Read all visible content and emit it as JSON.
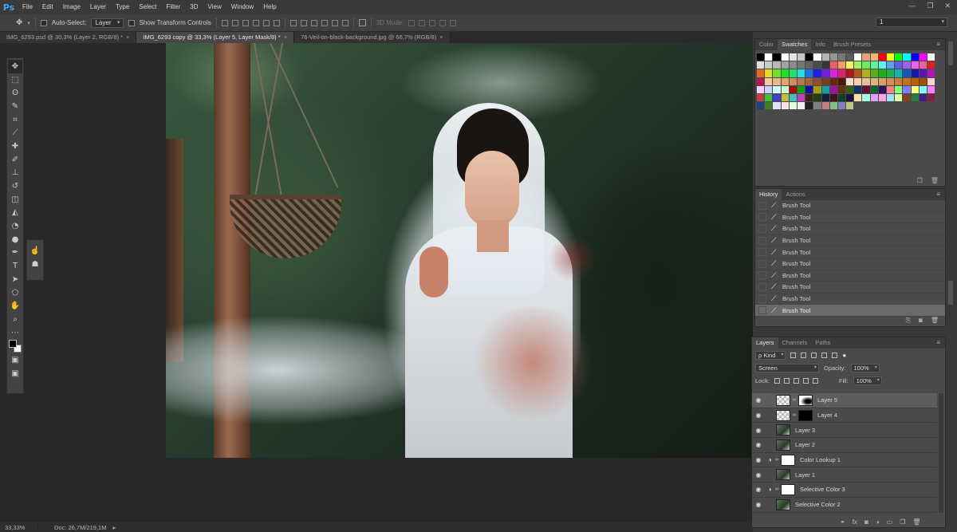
{
  "app": {
    "logo": "Ps",
    "menu": [
      "File",
      "Edit",
      "Image",
      "Layer",
      "Type",
      "Select",
      "Filter",
      "3D",
      "View",
      "Window",
      "Help"
    ],
    "window_controls": [
      "—",
      "❐",
      "✕"
    ]
  },
  "options": {
    "auto_select_label": "Auto-Select:",
    "auto_select_value": "Layer",
    "show_transform_label": "Show Transform Controls",
    "mode_3d_label": "3D Mode:",
    "workspace_value": "1"
  },
  "tabs": [
    {
      "label": "IMG_6293.psd @ 30,3% (Layer 2, RGB/8) *",
      "active": false
    },
    {
      "label": "IMG_6293 copy @ 33,3% (Layer 5, Layer Mask/8) *",
      "active": true
    },
    {
      "label": "76-Veil-on-black-background.jpg @ 66,7% (RGB/8)",
      "active": false
    }
  ],
  "tools": [
    "move-tool",
    "marquee-tool",
    "lasso-tool",
    "quick-select-tool",
    "crop-tool",
    "eyedropper-tool",
    "healing-tool",
    "brush-tool",
    "stamp-tool",
    "history-brush-tool",
    "eraser-tool",
    "paint-bucket-tool",
    "blur-tool",
    "dodge-tool",
    "pen-tool",
    "type-tool",
    "path-select-tool",
    "shape-tool",
    "hand-tool",
    "zoom-tool",
    "more-tools"
  ],
  "status": {
    "zoom": "33,33%",
    "doc": "Doc: 26,7M/219,1M"
  },
  "swatches_panel": {
    "tabs": [
      "Color",
      "Swatches",
      "Info",
      "Brush Presets"
    ],
    "active_tab": "Swatches",
    "colors": [
      "#000000",
      "#ffffff",
      "#000000",
      "#ffffff",
      "#e6e6e6",
      "#c8c8c8",
      "#000000",
      "#ffffff",
      "#b4b4b4",
      "#969696",
      "#787878",
      "#5a5a5a",
      "#ffffff",
      "#e8a080",
      "#f0b870",
      "#ff0000",
      "#ffff00",
      "#00ff00",
      "#00ffff",
      "#0000ff",
      "#ff00ff",
      "#f6f6f6",
      "#e0e0e0",
      "#cbcbcb",
      "#b6b6b6",
      "#a0a0a0",
      "#8b8b8b",
      "#767676",
      "#616161",
      "#4b4b4b",
      "#363636",
      "#f06060",
      "#f0a060",
      "#f0f060",
      "#a0f060",
      "#60f060",
      "#60f0a0",
      "#60f0f0",
      "#60a0f0",
      "#6060f0",
      "#a060f0",
      "#f060f0",
      "#f060a0",
      "#e02020",
      "#e07020",
      "#e0e020",
      "#70e020",
      "#20e020",
      "#20e070",
      "#20e0e0",
      "#2070e0",
      "#2020e0",
      "#7020e0",
      "#e020e0",
      "#e02070",
      "#b01818",
      "#b05818",
      "#b0b018",
      "#58b018",
      "#18b018",
      "#18b058",
      "#18b0b0",
      "#1858b0",
      "#1818b0",
      "#5818b0",
      "#b018b0",
      "#b01858",
      "#f4c8a0",
      "#e8b888",
      "#dca870",
      "#c89060",
      "#b47850",
      "#a06440",
      "#8c5030",
      "#783c20",
      "#642810",
      "#501800",
      "#f8e0c8",
      "#f0d0b0",
      "#e8c098",
      "#e0b080",
      "#d8a068",
      "#d09050",
      "#c88038",
      "#c07020",
      "#b86008",
      "#a05000",
      "#ffd0d0",
      "#ffd0ff",
      "#d0d0ff",
      "#d0ffff",
      "#d0ffd0",
      "#a01010",
      "#10a010",
      "#1010a0",
      "#a0a010",
      "#10a0a0",
      "#a010a0",
      "#603010",
      "#306010",
      "#103060",
      "#601030",
      "#106030",
      "#301060",
      "#ff8080",
      "#80ff80",
      "#8080ff",
      "#ffff80",
      "#80ffff",
      "#ff80ff",
      "#c04040",
      "#40c040",
      "#4040c0",
      "#c0c040",
      "#40c0c0",
      "#c040c0",
      "#402010",
      "#204010",
      "#102040",
      "#401020",
      "#104020",
      "#201040",
      "#ffe0a0",
      "#a0ffe0",
      "#e0a0ff",
      "#ffa0e0",
      "#a0e0ff",
      "#e0ffa0",
      "#804020",
      "#208040",
      "#402080",
      "#802040",
      "#204080",
      "#408020",
      "#e0e0ff",
      "#ffe0e0",
      "#e0ffe0",
      "#f0f0f0",
      "#202020",
      "#808080",
      "#c08080",
      "#80c080",
      "#8080c0",
      "#c0c080"
    ]
  },
  "history_panel": {
    "tabs": [
      "History",
      "Actions"
    ],
    "active_tab": "History",
    "items": [
      "Brush Tool",
      "Brush Tool",
      "Brush Tool",
      "Brush Tool",
      "Brush Tool",
      "Brush Tool",
      "Brush Tool",
      "Brush Tool",
      "Brush Tool",
      "Brush Tool"
    ],
    "active_index": 9
  },
  "layers_panel": {
    "tabs": [
      "Layers",
      "Channels",
      "Paths"
    ],
    "active_tab": "Layers",
    "filter_label": "ρ Kind",
    "blend_mode": "Screen",
    "opacity_label": "Opacity:",
    "opacity_value": "100%",
    "lock_label": "Lock:",
    "fill_label": "Fill:",
    "fill_value": "100%",
    "layers": [
      {
        "name": "Layer 5",
        "thumb": "checker",
        "mask": "mask5",
        "adj": false,
        "active": true
      },
      {
        "name": "Layer 4",
        "thumb": "checker",
        "mask": "black",
        "adj": false,
        "active": false
      },
      {
        "name": "Layer 3",
        "thumb": "photo",
        "mask": null,
        "adj": false,
        "active": false
      },
      {
        "name": "Layer 2",
        "thumb": "photo",
        "mask": null,
        "adj": false,
        "active": false
      },
      {
        "name": "Color Lookup 1",
        "thumb": null,
        "mask": "white",
        "adj": true,
        "active": false
      },
      {
        "name": "Layer 1",
        "thumb": "photo",
        "mask": null,
        "adj": false,
        "active": false
      },
      {
        "name": "Selective Color 3",
        "thumb": null,
        "mask": "white",
        "adj": true,
        "active": false
      },
      {
        "name": "Selective Color 2",
        "thumb": "photo",
        "mask": null,
        "adj": false,
        "active": false
      }
    ],
    "footer_icons": [
      "link-icon",
      "fx-icon",
      "mask-icon",
      "adjustment-icon",
      "group-icon",
      "new-layer-icon",
      "trash-icon"
    ]
  }
}
